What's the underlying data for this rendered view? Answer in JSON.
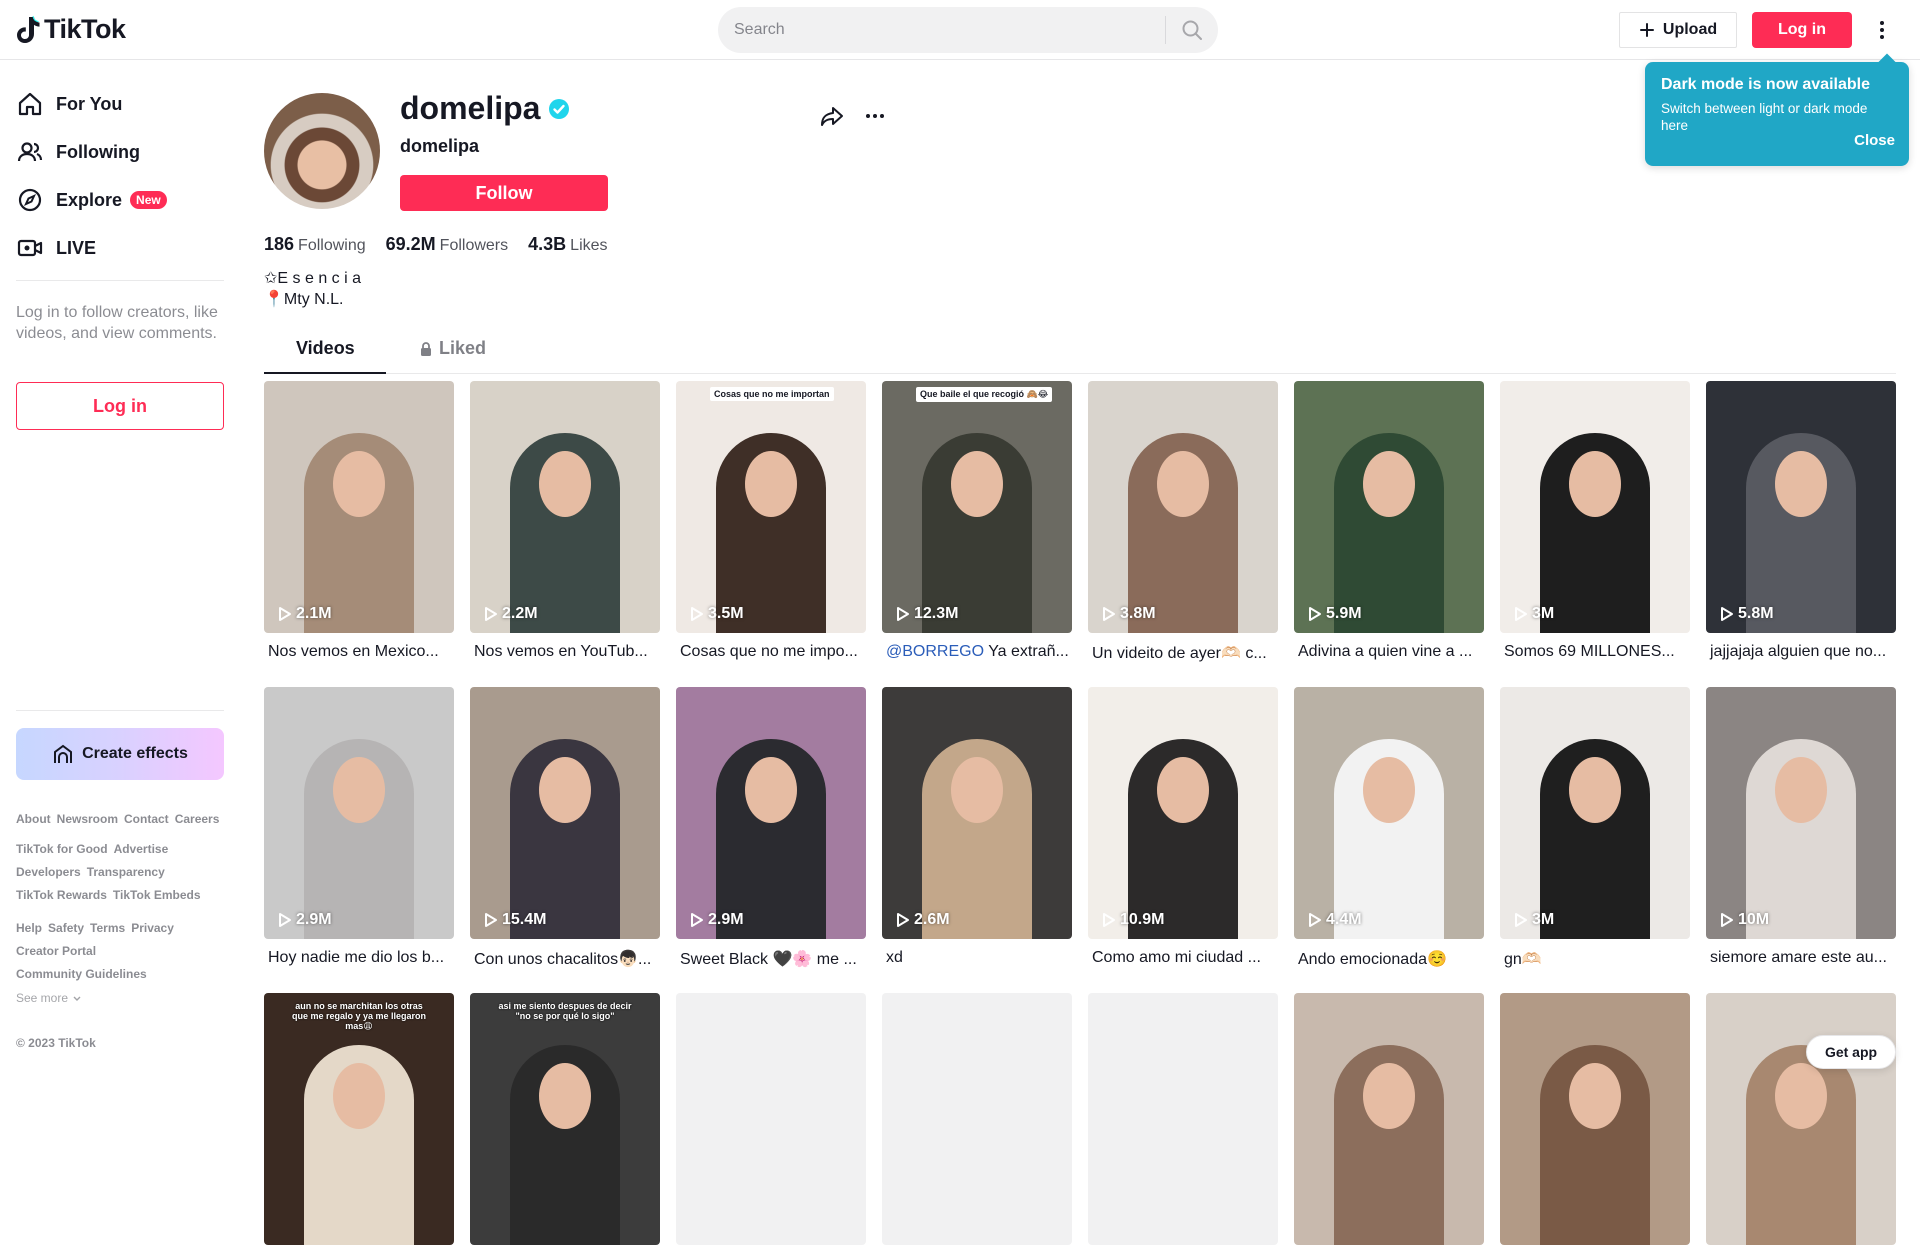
{
  "header": {
    "logo_text": "TikTok",
    "search_placeholder": "Search",
    "upload_label": "Upload",
    "login_label": "Log in"
  },
  "tooltip": {
    "title": "Dark mode is now available",
    "text": "Switch between light or dark mode here",
    "close_label": "Close"
  },
  "sidebar": {
    "nav": [
      {
        "label": "For You",
        "icon": "home-icon"
      },
      {
        "label": "Following",
        "icon": "people-icon"
      },
      {
        "label": "Explore",
        "icon": "compass-icon",
        "badge": "New"
      },
      {
        "label": "LIVE",
        "icon": "live-camera-icon"
      }
    ],
    "login_hint": "Log in to follow creators, like videos, and view comments.",
    "login_label": "Log in",
    "create_effects_label": "Create effects",
    "footer_links": [
      [
        "About",
        "Newsroom",
        "Contact",
        "Careers"
      ],
      [
        "TikTok for Good",
        "Advertise"
      ],
      [
        "Developers",
        "Transparency"
      ],
      [
        "TikTok Rewards",
        "TikTok Embeds"
      ],
      [
        "Help",
        "Safety",
        "Terms",
        "Privacy"
      ],
      [
        "Creator Portal"
      ],
      [
        "Community Guidelines"
      ]
    ],
    "see_more": "See more",
    "copyright": "© 2023 TikTok"
  },
  "profile": {
    "username": "domelipa",
    "subname": "domelipa",
    "follow_label": "Follow",
    "following_count": "186",
    "following_label": "Following",
    "followers_count": "69.2M",
    "followers_label": "Followers",
    "likes_count": "4.3B",
    "likes_label": "Likes",
    "bio_line1": "✩E s e n c i a",
    "bio_line2": "📍Mty N.L."
  },
  "tabs": {
    "videos": "Videos",
    "liked": "Liked"
  },
  "videos": [
    {
      "views": "2.1M",
      "title": "Nos vemos en Mexico..."
    },
    {
      "views": "2.2M",
      "title": "Nos vemos en YouTub..."
    },
    {
      "views": "3.5M",
      "title": "Cosas que no me impo...",
      "overlay": "Cosas que no me importan"
    },
    {
      "views": "12.3M",
      "mention": "@BORREGO",
      "title": " Ya extrañ...",
      "overlay": "Que baile el que recogió 🙈😂"
    },
    {
      "views": "3.8M",
      "title": "Un videito de ayer🫶🏻 c..."
    },
    {
      "views": "5.9M",
      "title": "Adivina a quien vine a ..."
    },
    {
      "views": "3M",
      "title": "Somos 69 MILLONES..."
    },
    {
      "views": "5.8M",
      "title": "jajjajaja alguien que no..."
    },
    {
      "views": "2.9M",
      "title": "Hoy nadie me dio los b..."
    },
    {
      "views": "15.4M",
      "title": "Con unos chacalitos👦🏻..."
    },
    {
      "views": "2.9M",
      "title": "Sweet Black 🖤🌸 me ..."
    },
    {
      "views": "2.6M",
      "title": "xd"
    },
    {
      "views": "10.9M",
      "title": "Como amo mi ciudad ..."
    },
    {
      "views": "4.4M",
      "title": "Ando emocionada☺️"
    },
    {
      "views": "3M",
      "title": "gn🫶🏻"
    },
    {
      "views": "10M",
      "title": "siemore amare este au..."
    },
    {
      "overlay": "aun no se marchitan los otras que me regalo y ya me llegaron mas😩"
    },
    {
      "overlay": "asi me siento despues de decir \"no se por qué lo sigo\""
    },
    {},
    {},
    {},
    {},
    {},
    {}
  ],
  "get_app_label": "Get app",
  "colors": {
    "accent": "#fe2c55",
    "tooltip_bg": "#20a7c6",
    "verified": "#20d5ec",
    "mention": "#2b5db9"
  }
}
